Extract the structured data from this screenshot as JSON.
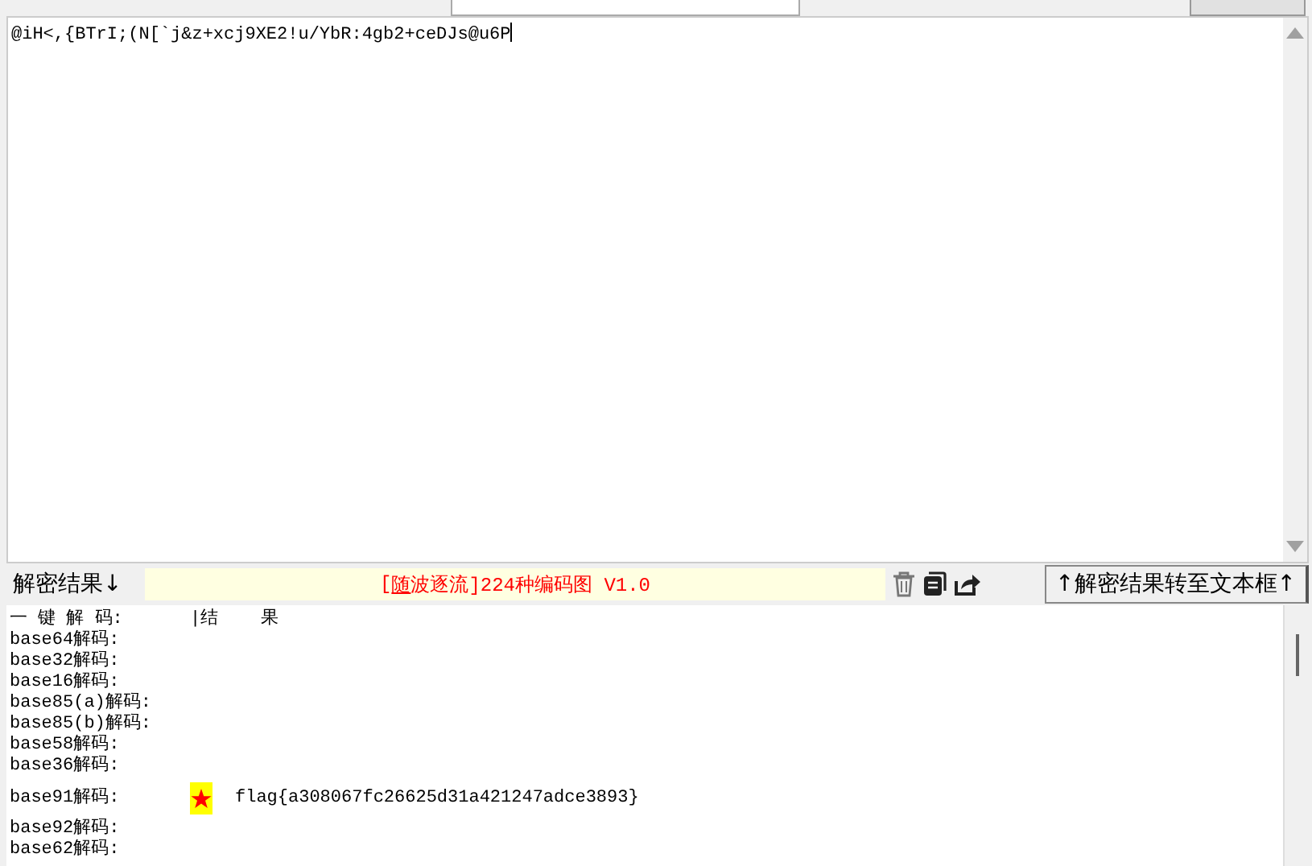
{
  "input": {
    "value": "@iH<,{BTrI;(N[`j&z+xcj9XE2!u/YbR:4gb2+ceDJs@u6P"
  },
  "result_bar": {
    "label": "解密结果↓",
    "banner_bracket_open": "[",
    "banner_underlined": "随",
    "banner_rest": "波逐流]224种编码图 V1.0",
    "transfer_button": "↑解密结果转至文本框↑"
  },
  "output": {
    "header_left": "一 键 解 码:",
    "header_right": "|结    果",
    "rows": [
      {
        "label": "base64解码:",
        "starred": false
      },
      {
        "label": "base32解码:",
        "starred": false
      },
      {
        "label": "base16解码:",
        "starred": false
      },
      {
        "label": "base85(a)解码:",
        "starred": false
      },
      {
        "label": "base85(b)解码:",
        "starred": false
      },
      {
        "label": "base58解码:",
        "starred": false
      },
      {
        "label": "base36解码:",
        "starred": false
      },
      {
        "label": "base91解码:",
        "starred": true,
        "result": "flag{a308067fc26625d31a421247adce3893}"
      },
      {
        "label": "base92解码:",
        "starred": false
      },
      {
        "label": "base62解码:",
        "starred": false
      }
    ]
  }
}
